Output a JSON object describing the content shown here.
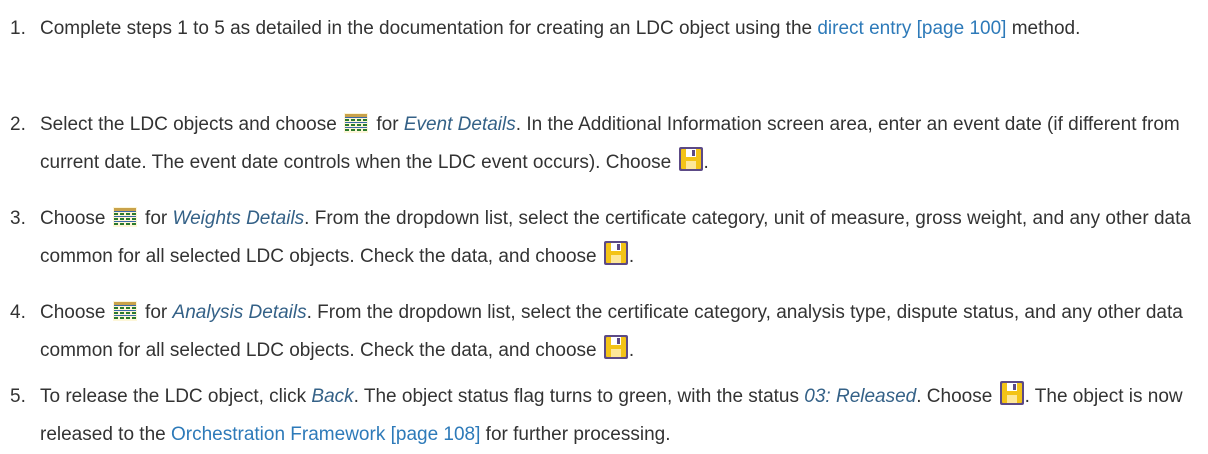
{
  "steps": [
    {
      "number": "1.",
      "text_a": "Complete steps 1 to 5 as detailed in the documentation for creating an LDC object using the ",
      "link": "direct entry [page 100]",
      "text_b": " method."
    },
    {
      "number": "2.",
      "text_a": "Select the LDC objects and choose ",
      "text_b": " for ",
      "term": "Event Details",
      "text_c": ". In the Additional Information screen area, enter an event date (if different from current date. The event date controls when the LDC event occurs). Choose ",
      "text_d": "."
    },
    {
      "number": "3.",
      "text_a": "Choose ",
      "text_b": " for ",
      "term": "Weights Details",
      "text_c": ". From the dropdown list, select the certificate category, unit of measure, gross weight, and any other data common for all selected LDC objects. Check the data, and choose ",
      "text_d": "."
    },
    {
      "number": "4.",
      "text_a": "Choose ",
      "text_b": " for ",
      "term": "Analysis Details",
      "text_c": ". From the dropdown list, select the certificate category, analysis type, dispute status, and any other data common for all selected LDC objects. Check the data, and choose ",
      "text_d": "."
    },
    {
      "number": "5.",
      "text_a": "To release the LDC object, click ",
      "term_a": "Back",
      "text_b": ". The object status flag turns to green, with the status ",
      "term_b": "03: Released",
      "text_c": ". Choose ",
      "text_d": ". The object is now released to the ",
      "link": "Orchestration Framework [page 108]",
      "text_e": " for further processing."
    }
  ],
  "icons": {
    "details": "multi-row-details-icon",
    "save": "save-floppy-icon"
  },
  "colors": {
    "body_text": "#333333",
    "link": "#2d7ab9",
    "term": "#346187",
    "save_icon_fill": "#f3c317",
    "details_icon": "#2b7a2b"
  }
}
